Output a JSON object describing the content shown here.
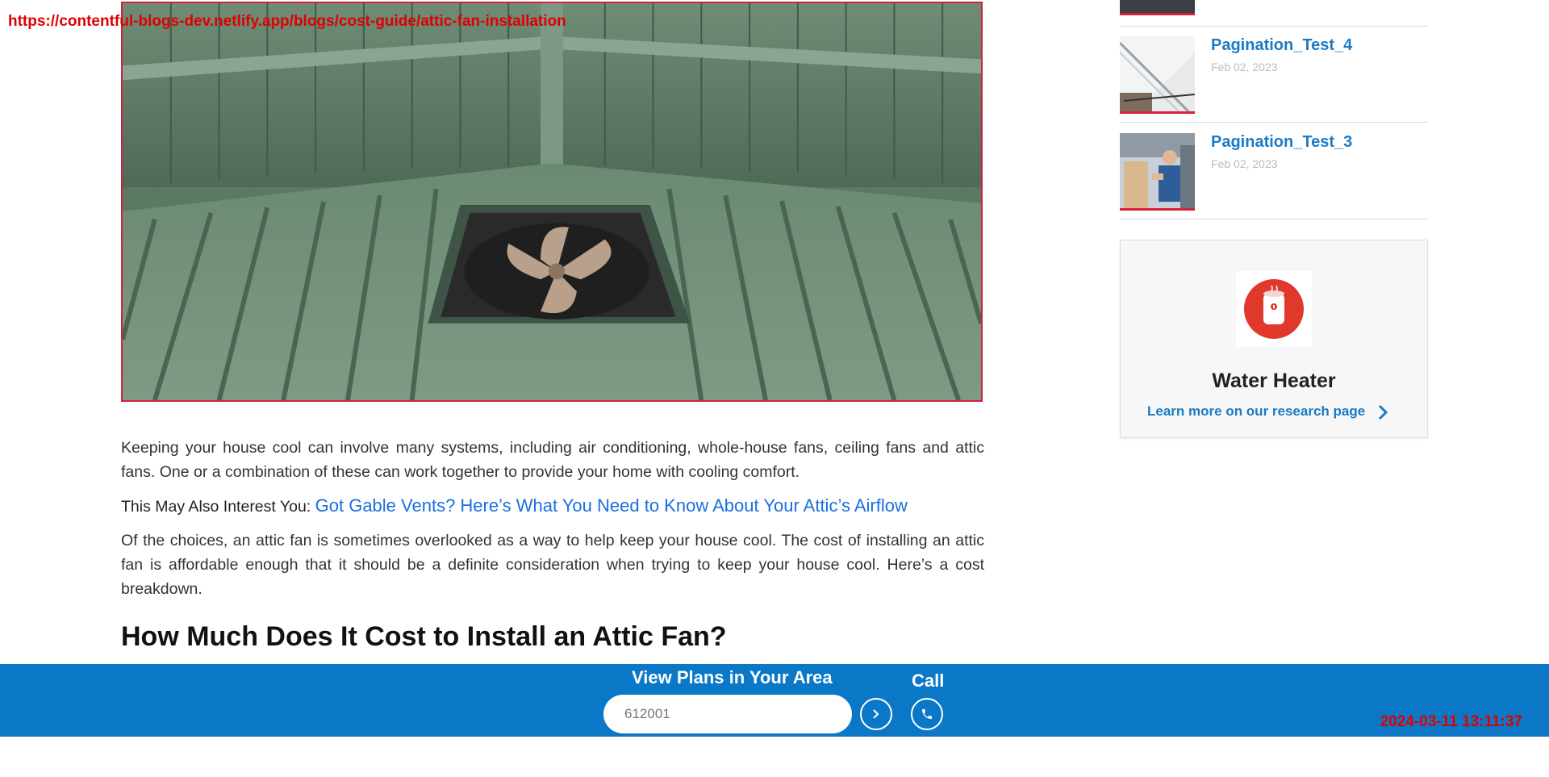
{
  "browser": {
    "url": "https://contentful-blogs-dev.netlify.app/blogs/cost-guide/attic-fan-installation",
    "timestamp": "2024-03-11 13:11:37"
  },
  "hero": {
    "alt": "attic fan"
  },
  "article": {
    "paragraph_1": "Keeping your house cool can involve many systems, including air conditioning, whole-house fans, ceiling fans and attic fans. One or a combination of these can work together to provide your home with cooling comfort.",
    "interest_label": "This May Also Interest You:",
    "interest_link": "Got Gable Vents? Here’s What You Need to Know About Your Attic’s Airflow",
    "paragraph_2": "Of the choices, an attic fan is sometimes overlooked as a way to help keep your house cool. The cost of installing an attic fan is affordable enough that it should be a definite consideration when trying to keep your house cool. Here’s a cost breakdown.",
    "heading": "How Much Does It Cost to Install an Attic Fan?"
  },
  "sidebar": {
    "posts": [
      {
        "title": "Pagination_Test_4",
        "date": "Feb 02, 2023"
      },
      {
        "title": "Pagination_Test_3",
        "date": "Feb 02, 2023"
      }
    ],
    "card": {
      "title": "Water Heater",
      "link": "Learn more on our research page",
      "icon": "water-heater-icon"
    }
  },
  "bottom_bar": {
    "plans_label": "View Plans in Your Area",
    "zip_value": "612001",
    "call_label": "Call"
  },
  "colors": {
    "brand_blue": "#0a78c6",
    "link_blue": "#1b7bc4",
    "accent_red": "#d6203a"
  }
}
